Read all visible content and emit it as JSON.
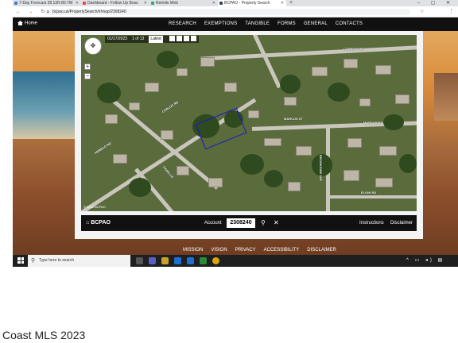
{
  "browser": {
    "tabs": [
      {
        "label": "7-Day Forecast 28.13N 80.7W",
        "active": false
      },
      {
        "label": "Dashboard - Follow Up Boss",
        "active": false
      },
      {
        "label": "Reimils Web",
        "active": false
      },
      {
        "label": "BCPAO - Property Search",
        "active": true
      }
    ],
    "new_tab": "+",
    "url": "bcpao.us/PropertySearch/#/map/2308240",
    "nav": "← → ↻",
    "window_controls": "– ▢ ✕"
  },
  "site": {
    "home_label": "Home",
    "menu": [
      "RESEARCH",
      "EXEMPTIONS",
      "TANGIBLE",
      "FORMS",
      "GENERAL",
      "CONTACTS"
    ],
    "footer": [
      "MISSION",
      "VISION",
      "PRIVACY",
      "ACCESSIBILITY",
      "DISCLAIMER"
    ]
  },
  "map": {
    "date": "01/17/2023",
    "page_indicator": "1 of 13",
    "latest_label": "Latest",
    "zoom_in": "+",
    "zoom_out": "−",
    "compass": "✥",
    "road_labels": {
      "carrick": "CARRICK RD",
      "marcus_left": "MARCUS ST",
      "marcus_right": "MARCUS ST",
      "carlos": "CARLOS RD",
      "abrego": "ABREGO RD",
      "tiger": "TIGER LN",
      "brookside": "BROOKSIDE AVE",
      "elgin": "ELGIN RD"
    },
    "credit": "© 2023 BCPAO"
  },
  "map_bar": {
    "brand": "BCPAO",
    "account_label": "Account",
    "account_value": "2308240",
    "instructions": "Instructions",
    "disclaimer": "Disclaimer"
  },
  "taskbar": {
    "search_placeholder": "Type here to search",
    "tray": "^ ▭ ◂) ▤"
  },
  "watermark": "Coast MLS 2023",
  "colors": {
    "parcel_outline": "#1e12d6",
    "nav_bg": "#111111"
  }
}
